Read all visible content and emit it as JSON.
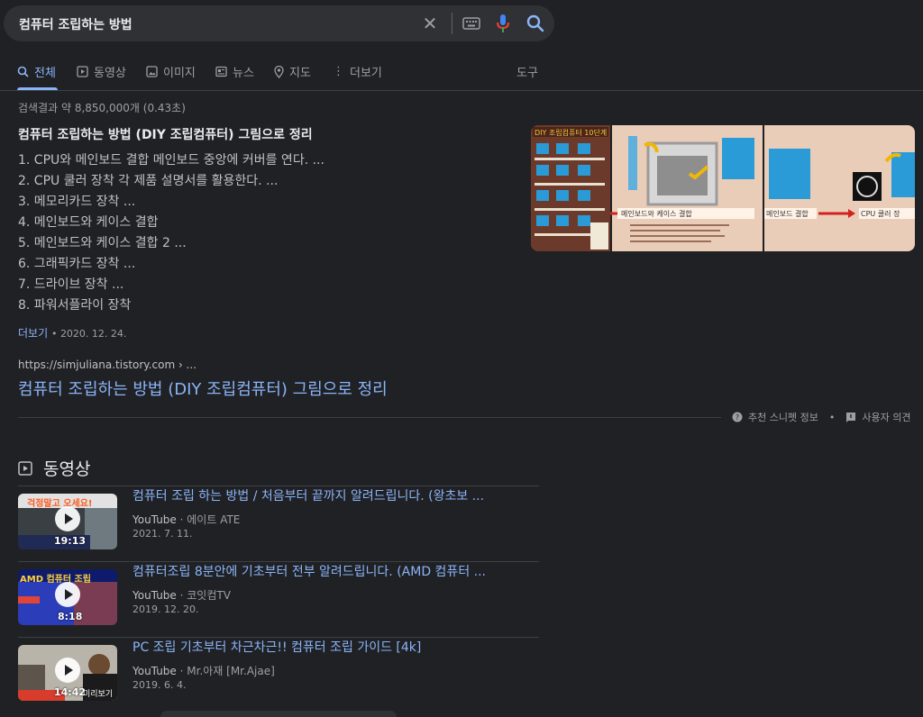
{
  "search": {
    "query": "컴퓨터 조립하는 방법"
  },
  "tabs": [
    {
      "label": "전체",
      "icon": "search-icon",
      "active": true
    },
    {
      "label": "동영상",
      "icon": "play-icon"
    },
    {
      "label": "이미지",
      "icon": "image-icon"
    },
    {
      "label": "뉴스",
      "icon": "news-icon"
    },
    {
      "label": "지도",
      "icon": "map-pin-icon"
    },
    {
      "label": "더보기",
      "icon": "more-vert-icon"
    }
  ],
  "tools_label": "도구",
  "results_count": "검색결과 약 8,850,000개 (0.43초)",
  "snippet": {
    "title": "컴퓨터 조립하는 방법 (DIY 조립컴퓨터) 그림으로 정리",
    "steps": [
      "1. CPU와 메인보드 결합 메인보드 중앙에 커버를 연다. ...",
      "2. CPU 쿨러 장착 각 제품 설명서를 활용한다. ...",
      "3. 메모리카드 장착 ...",
      "4. 메인보드와 케이스 결합",
      "5. 메인보드와 케이스 결합 2  ...",
      "6. 그래픽카드 장착 ...",
      "7. 드라이브 장착 ...",
      "8. 파워서플라이 장착"
    ],
    "more_label": "더보기",
    "date": "• 2020. 12. 24.",
    "image_texts": {
      "panel1": "DIY 조립컴퓨터 10단계",
      "panel2": "메인보드와 케이스 결합",
      "panel3a": "메인보드 결합",
      "panel3b": "CPU 쿨러 장"
    },
    "source_url": "https://simjuliana.tistory.com › ...",
    "link_title": "컴퓨터 조립하는 방법 (DIY 조립컴퓨터) 그림으로 정리",
    "footer_about": "추천 스니펫 정보",
    "footer_dot": "•",
    "footer_feedback": "사용자 의견"
  },
  "videos": {
    "heading": "동영상",
    "items": [
      {
        "title": "컴퓨터 조립 하는 방법 / 처음부터 끝까지 알려드립니다. (왕초보 ...",
        "source": "YouTube",
        "channel": "· 에이트 ATE",
        "date": "2021. 7. 11.",
        "duration": "19:13",
        "thumb_text": "걱정말고 오세요!"
      },
      {
        "title": "컴퓨터조립 8분안에 기초부터 전부 알려드립니다. (AMD 컴퓨터 ...",
        "source": "YouTube",
        "channel": "· 코잇컴TV",
        "date": "2019. 12. 20.",
        "duration": "8:18",
        "thumb_text": "AMD 컴퓨터 조립"
      },
      {
        "title": "PC 조립 기초부터 차근차근!! 컴퓨터 조립 가이드 [4k]",
        "source": "YouTube",
        "channel": "· Mr.아재 [Mr.Ajae]",
        "date": "2019. 6. 4.",
        "duration": "14:42",
        "thumb_text": "미리보기"
      }
    ]
  },
  "colors": {
    "background": "#202124",
    "link": "#8ab4f8",
    "text": "#bdc1c6",
    "heading": "#e8eaed"
  }
}
